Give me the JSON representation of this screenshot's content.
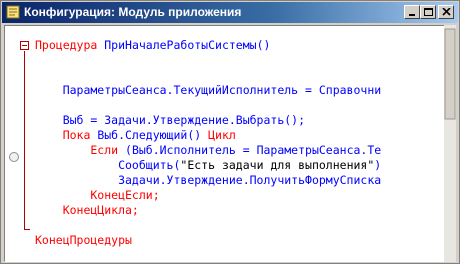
{
  "window": {
    "title": "Конфигурация: Модуль приложения"
  },
  "code": {
    "lines": [
      [
        {
          "t": "Процедура ",
          "c": "kw"
        },
        {
          "t": "ПриНачалеРаботыСистемы()",
          "c": "fn"
        }
      ],
      [],
      [],
      [
        {
          "t": "    ПараметрыСеанса.ТекущийИсполнитель = Справочни",
          "c": "fn"
        }
      ],
      [],
      [
        {
          "t": "    Выб = Задачи.Утверждение.Выбрать();",
          "c": "fn"
        }
      ],
      [
        {
          "t": "    Пока ",
          "c": "kw"
        },
        {
          "t": "Выб.Следующий() ",
          "c": "fn"
        },
        {
          "t": "Цикл",
          "c": "kw"
        }
      ],
      [
        {
          "t": "        Если ",
          "c": "kw"
        },
        {
          "t": "(Выб.Исполнитель = ПараметрыСеанса.Те",
          "c": "fn"
        }
      ],
      [
        {
          "t": "            Сообщить(",
          "c": "fn"
        },
        {
          "t": "\"Есть задачи для выполнения\"",
          "c": "str"
        },
        {
          "t": ")",
          "c": "fn"
        }
      ],
      [
        {
          "t": "            Задачи.Утверждение.ПолучитьФормуСписка",
          "c": "fn"
        }
      ],
      [
        {
          "t": "        КонецЕсли;",
          "c": "kw"
        }
      ],
      [
        {
          "t": "    КонецЦикла;",
          "c": "kw"
        }
      ],
      [],
      [
        {
          "t": "КонецПроцедуры",
          "c": "kw"
        }
      ]
    ]
  },
  "colors": {
    "keyword": "#ff0000",
    "identifier": "#0000ff",
    "string": "#000000",
    "title_bar": "#0a246a"
  },
  "icons": [
    "module-icon",
    "minimize-icon",
    "maximize-icon",
    "close-icon",
    "collapse-icon",
    "breakpoint-icon"
  ]
}
